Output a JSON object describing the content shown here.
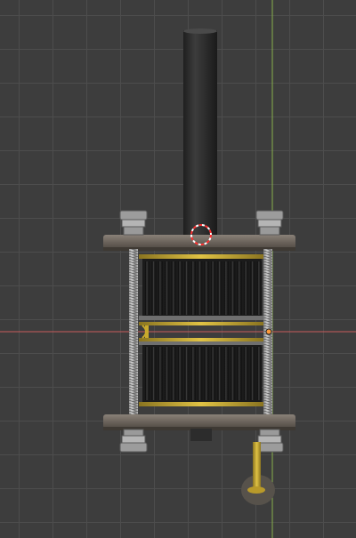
{
  "viewport": {
    "background_color": "#3d3d3d",
    "grid_color": "#4d4d4d",
    "x_axis_color": "#c85a5a",
    "y_axis_color": "#86b04a"
  },
  "model": {
    "shaft_color": "#333333",
    "plate_color": "#6e665e",
    "rod_color": "#b8b8b8",
    "nut_color": "#a9a9a9",
    "capacitor_plate_color": "#1a1a1a",
    "brass_color": "#c9a92c",
    "cursor_color": "#ff3030"
  },
  "icons": [
    "3d-cursor-icon",
    "origin-dot-icon"
  ]
}
